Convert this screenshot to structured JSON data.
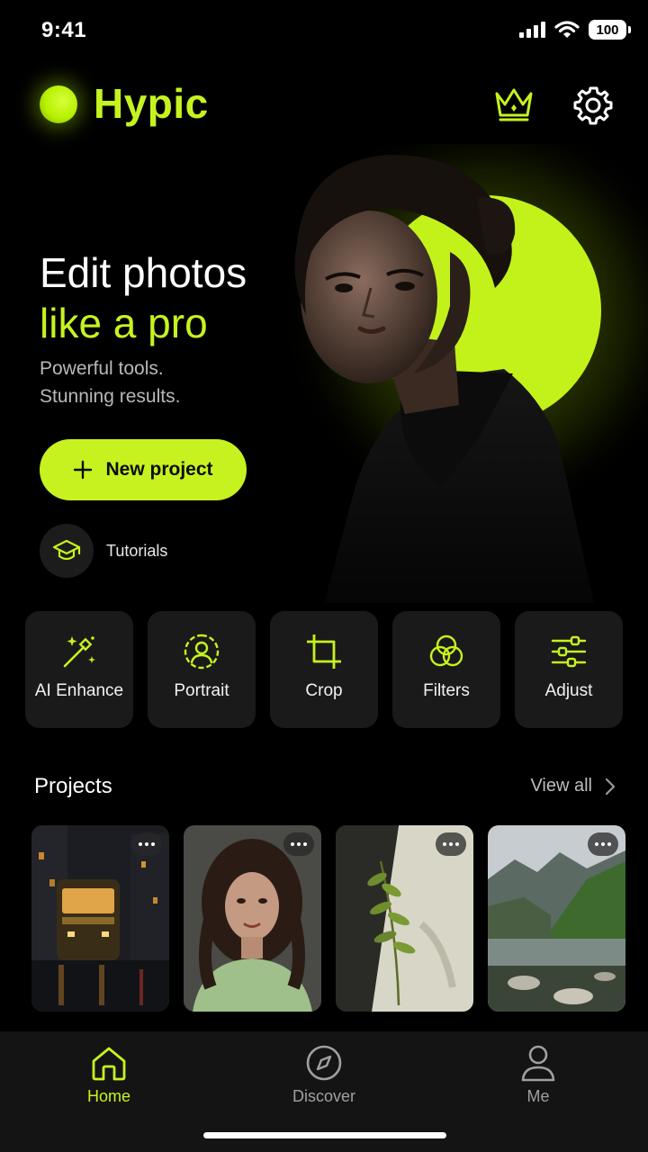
{
  "status_bar": {
    "time": "9:41",
    "battery": "100"
  },
  "header": {
    "app_name": "Hypic"
  },
  "hero": {
    "title_line1": "Edit photos",
    "title_line2": "like a pro",
    "subtitle_line1": "Powerful tools.",
    "subtitle_line2": "Stunning results.",
    "primary_button": "New project",
    "tutorials_label": "Tutorials"
  },
  "tools": [
    {
      "label": "AI Enhance",
      "icon": "magic-wand-icon"
    },
    {
      "label": "Portrait",
      "icon": "portrait-icon"
    },
    {
      "label": "Crop",
      "icon": "crop-icon"
    },
    {
      "label": "Filters",
      "icon": "filters-icon"
    },
    {
      "label": "Adjust",
      "icon": "sliders-icon"
    }
  ],
  "projects": {
    "title": "Projects",
    "view_all": "View all"
  },
  "tab_bar": {
    "items": [
      {
        "label": "Home",
        "icon": "home-icon",
        "active": true
      },
      {
        "label": "Discover",
        "icon": "compass-icon",
        "active": false
      },
      {
        "label": "Me",
        "icon": "user-icon",
        "active": false
      }
    ]
  },
  "colors": {
    "accent": "#c6f31f",
    "background": "#000000",
    "card": "#1a1a1a",
    "tab_bar": "#141414"
  }
}
